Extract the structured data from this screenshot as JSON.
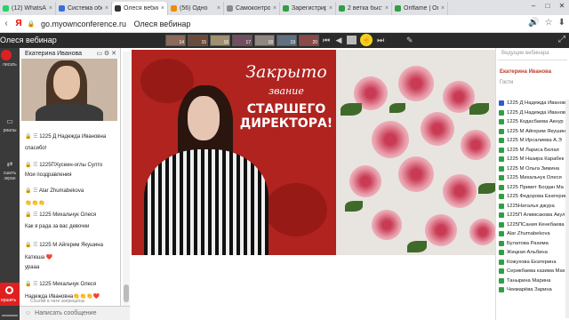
{
  "browser": {
    "tabs": [
      {
        "label": "(12) WhatsApp",
        "color": "#25d366",
        "active": false
      },
      {
        "label": "Система обслу",
        "color": "#3a6fd8",
        "active": false
      },
      {
        "label": "Олеся вебинар",
        "color": "#333333",
        "active": true
      },
      {
        "label": "(56) Одно",
        "color": "#f08c00",
        "active": false
      },
      {
        "label": "Самоконтроль",
        "color": "#8a8a8a",
        "active": false
      },
      {
        "label": "Зарегистриров",
        "color": "#2ea043",
        "active": false
      },
      {
        "label": "2 ветка быстро",
        "color": "#2ea043",
        "active": false
      },
      {
        "label": "Oriflame | Orifla",
        "color": "#2ea043",
        "active": false
      }
    ],
    "url_host": "go.myownconference.ru",
    "url_title": "Олеся вебинар"
  },
  "app": {
    "page_title": "Олеся вебинар",
    "slide_numbers": [
      "14",
      "15",
      "16",
      "17",
      "18",
      "19",
      "20"
    ]
  },
  "sidebar": {
    "record_label": "писать",
    "materials_label": "риалы",
    "share_label": "сшить экран",
    "stop_label": "ершить"
  },
  "chat": {
    "presenter_name": "Екатерина Иванова",
    "messages": [
      {
        "author": "1225 Д Надежда Ивановна",
        "text": "спасибо!"
      },
      {
        "author": "1225ПХусеин-оглы Султо",
        "text": "Мои поздравления"
      },
      {
        "author": "Alar Zhumabekova",
        "text": "👏👏👏"
      },
      {
        "author": "1225 Михальчук Олеся",
        "text": "Как я рада за вас девочки"
      },
      {
        "author": "1225 М Айгерим Якушина",
        "text": "Катюша ❤️"
      },
      {
        "author": "",
        "text": "урааа"
      },
      {
        "author": "1225 Михальчук Олеся",
        "text": "Надежда Ивановна👏👏👏❤️"
      }
    ],
    "footer": "Ссылки в чате запрещены",
    "input_placeholder": "Написать сообщение"
  },
  "slide": {
    "line1": "Закрыто",
    "line2": "звание",
    "line3": "СТАРШЕГО",
    "line4": "ДИРЕКТОРА!"
  },
  "participants": {
    "search_placeholder": "Ведущие вебинара",
    "host": "Екатерина Иванова",
    "guests_label": "Гости",
    "list": [
      "1225 Д Надежда Иванова",
      "1225 Д Надежда Иванова",
      "1225 Кодасбаева Акнур",
      "1225 М Айгерим Якушина",
      "1225 М Ирсалиева А.Э",
      "1225 М Лариса Белая",
      "1225 М Назира Карабек",
      "1225 М Ольга Зимина",
      "1225 Михальчук Олеся",
      "1225 Привет Богдан Ма",
      "1225 Федорова Екатерина",
      "1225Наталья джура",
      "1225П Алимсакова Акул",
      "1225ПСания Кенебаева",
      "Alar Zhumabekova",
      "Булатова Рахима",
      "Жицкая Альбина",
      "Кожухова Екатерина",
      "Серикбаева казима Мах",
      "Танырина Марина",
      "Чекмарёва Зарина"
    ]
  }
}
